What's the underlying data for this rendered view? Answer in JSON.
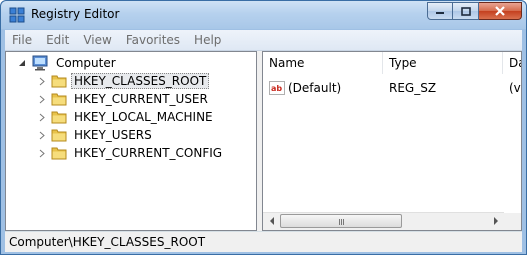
{
  "window": {
    "title": "Registry Editor"
  },
  "menu": [
    "File",
    "Edit",
    "View",
    "Favorites",
    "Help"
  ],
  "tree": {
    "root": "Computer",
    "hives": [
      "HKEY_CLASSES_ROOT",
      "HKEY_CURRENT_USER",
      "HKEY_LOCAL_MACHINE",
      "HKEY_USERS",
      "HKEY_CURRENT_CONFIG"
    ],
    "selected_index": 0
  },
  "list": {
    "columns": [
      "Name",
      "Type",
      "Da"
    ],
    "rows": [
      {
        "name": "(Default)",
        "type": "REG_SZ",
        "data": "(v"
      }
    ]
  },
  "status": {
    "path": "Computer\\HKEY_CLASSES_ROOT"
  },
  "colors": {
    "title_gradient": "#b6d1ee",
    "close_button": "#c4401f",
    "folder": "#e8c24a"
  }
}
